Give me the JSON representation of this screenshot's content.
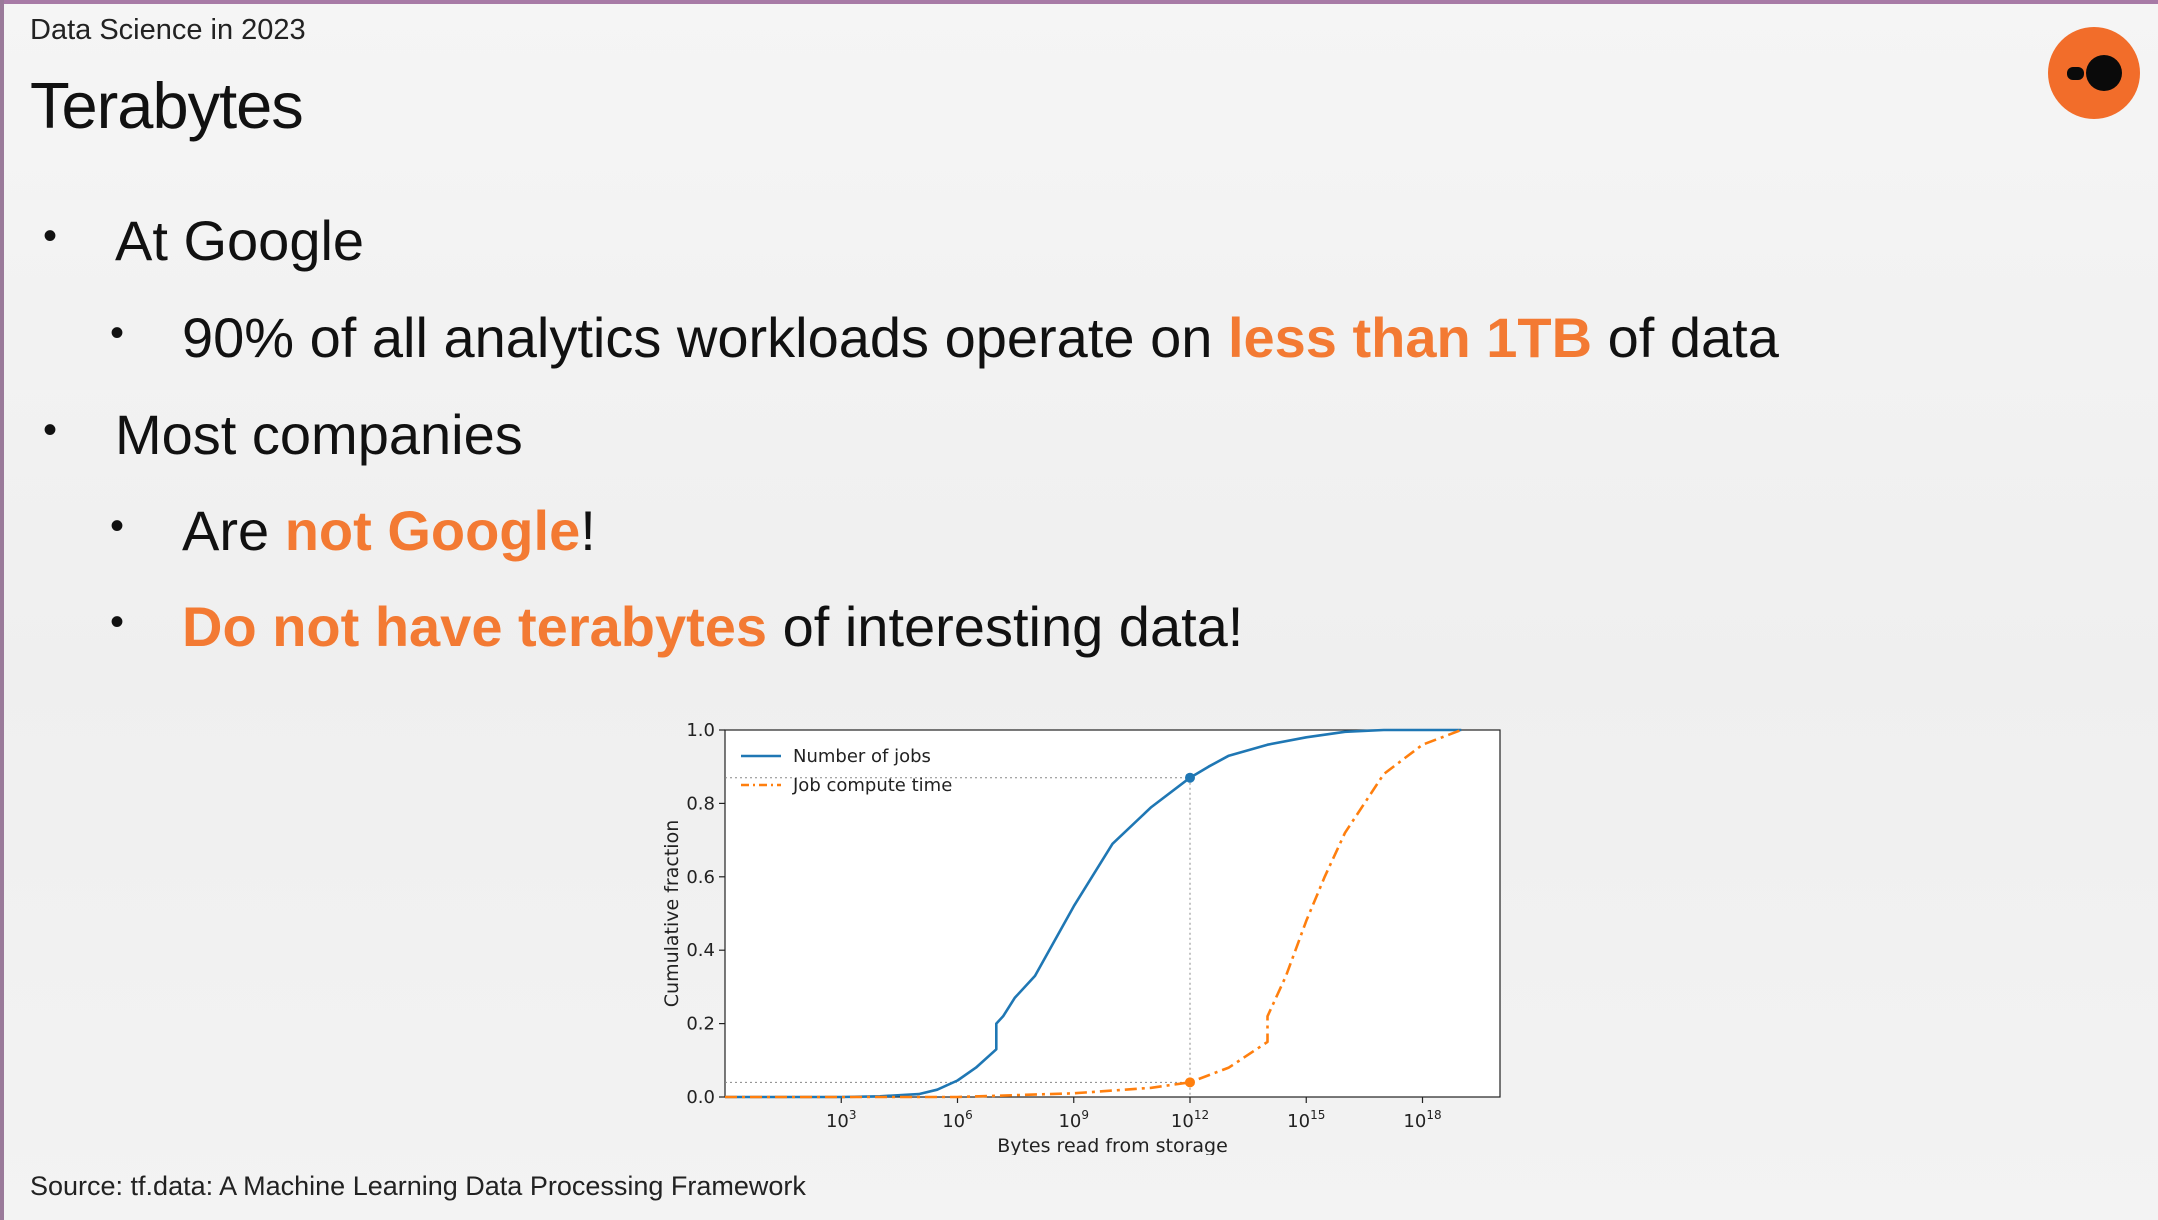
{
  "slide": {
    "kicker": "Data Science in 2023",
    "title": "Terabytes",
    "source": "Source: tf.data: A Machine Learning Data Processing Framework",
    "accent_color": "#f37a33",
    "logo": "orange-circle-logo-icon"
  },
  "bullets": {
    "b1": "At Google",
    "b2_pre": "90% of all analytics workloads operate on ",
    "b2_hl": "less than 1TB",
    "b2_post": " of data",
    "b3": "Most companies",
    "b4_pre": "Are ",
    "b4_hl": "not Google",
    "b4_post": "!",
    "b5_hl": "Do not have terabytes",
    "b5_post": " of interesting data!"
  },
  "chart_data": {
    "type": "line",
    "xlabel": "Bytes read from storage",
    "ylabel": "Cumulative fraction",
    "x_scale": "log",
    "x_ticks": [
      {
        "value": 1000,
        "base": "10",
        "exp": "3"
      },
      {
        "value": 1000000,
        "base": "10",
        "exp": "6"
      },
      {
        "value": 1000000000,
        "base": "10",
        "exp": "9"
      },
      {
        "value": 1000000000000,
        "base": "10",
        "exp": "12"
      },
      {
        "value": 1000000000000000,
        "base": "10",
        "exp": "15"
      },
      {
        "value": 1000000000000000000,
        "base": "10",
        "exp": "18"
      }
    ],
    "xlim": [
      1,
      1e+20
    ],
    "ylim": [
      0,
      1
    ],
    "y_ticks": [
      "0.0",
      "0.2",
      "0.4",
      "0.6",
      "0.8",
      "1.0"
    ],
    "legend_position": "upper-left",
    "series": [
      {
        "name": "Number of jobs",
        "color": "#1f77b4",
        "style": "solid",
        "x": [
          1,
          1000.0,
          10000.0,
          100000.0,
          300000.0,
          1000000.0,
          3000000.0,
          10000000.0,
          10000000.0,
          15000000.0,
          30000000.0,
          100000000.0,
          1000000000.0,
          10000000000.0,
          100000000000.0,
          1000000000000.0,
          3000000000000.0,
          10000000000000.0,
          100000000000000.0,
          1000000000000000.0,
          1e+16,
          1e+17,
          1e+18,
          1e+19
        ],
        "y": [
          0.0,
          0.0,
          0.002,
          0.008,
          0.02,
          0.045,
          0.08,
          0.13,
          0.2,
          0.22,
          0.27,
          0.33,
          0.52,
          0.69,
          0.79,
          0.87,
          0.9,
          0.93,
          0.96,
          0.98,
          0.995,
          1.0,
          1.0,
          1.0
        ]
      },
      {
        "name": "Job compute time",
        "color": "#ff7f0e",
        "style": "dashdot",
        "x": [
          1,
          1000000.0,
          1000000000.0,
          100000000000.0,
          1000000000000.0,
          10000000000000.0,
          100000000000000.0,
          100000000000000.0,
          300000000000000.0,
          1000000000000000.0,
          3000000000000000.0,
          1e+16,
          1e+17,
          1e+18,
          1e+19
        ],
        "y": [
          0.0,
          0.0,
          0.01,
          0.025,
          0.04,
          0.08,
          0.15,
          0.22,
          0.33,
          0.48,
          0.6,
          0.72,
          0.88,
          0.96,
          1.0
        ]
      }
    ],
    "markers": [
      {
        "series": "Number of jobs",
        "x": 1000000000000.0,
        "y": 0.87
      },
      {
        "series": "Job compute time",
        "x": 1000000000000.0,
        "y": 0.04
      }
    ]
  }
}
